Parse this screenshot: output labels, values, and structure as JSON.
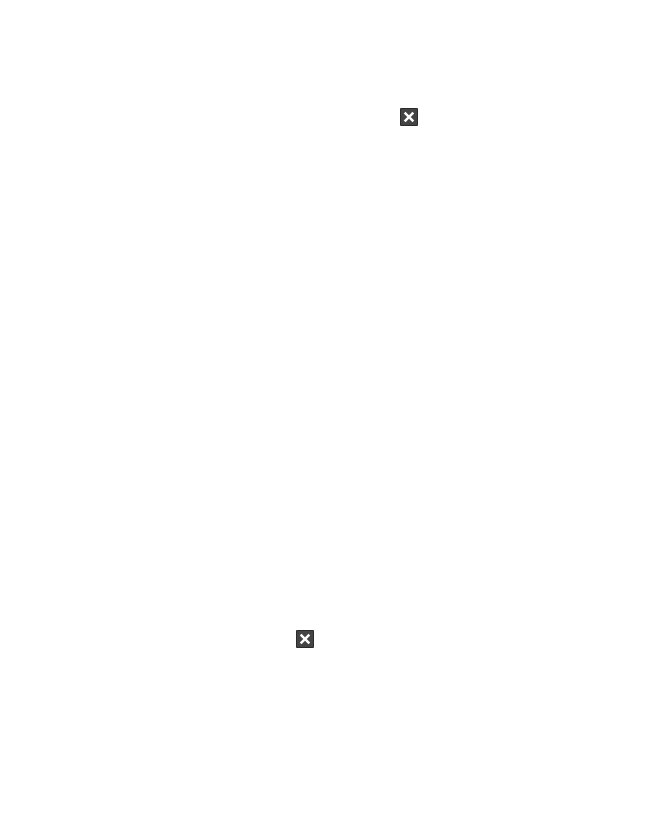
{
  "page": {
    "background": "#ffffff"
  },
  "controls": {
    "close_buttons": [
      {
        "icon": "close-icon",
        "color": "#444444",
        "glyph_color": "#ffffff"
      },
      {
        "icon": "close-icon",
        "color": "#444444",
        "glyph_color": "#ffffff"
      }
    ]
  }
}
